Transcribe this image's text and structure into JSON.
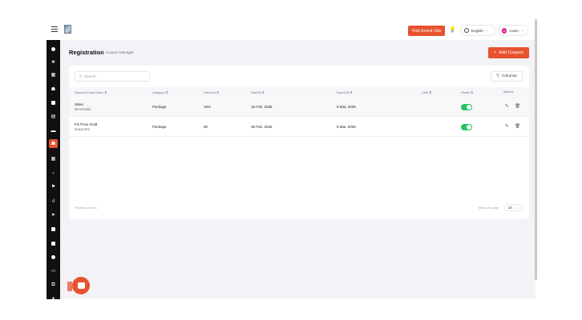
{
  "topbar": {
    "visit_event_site": "Visit Event Site",
    "language": "English",
    "user_name": "Azam",
    "user_initial": "A"
  },
  "page": {
    "title": "Registration",
    "breadcrumb": "Coupon Manager",
    "add_coupon": "Add Coupon"
  },
  "table": {
    "search_placeholder": "Search",
    "columns_label": "Columns",
    "headers": [
      "Discount Code Name",
      "Category",
      "Discount",
      "Start At",
      "Expire At",
      "Limit",
      "Status",
      "Actions"
    ],
    "rows": [
      {
        "name": "Silver",
        "code": "WFH1S0WE",
        "category": "Package",
        "discount": "10%",
        "start": "15 Feb, 2025",
        "expire": "8 Mar, 2025",
        "limit": "",
        "status": "on"
      },
      {
        "name": "Fix Price Gold",
        "code": "SHA2KSRX",
        "category": "Package",
        "discount": "50",
        "start": "25 Feb, 2025",
        "expire": "8 Mar, 2025",
        "limit": "",
        "status": "on"
      }
    ],
    "showing": "Showing 2 items",
    "rows_per_page_label": "Items per page",
    "rows_per_page": "10"
  },
  "icons": {
    "sidebar": [
      "circle-icon",
      "star-icon",
      "grid-icon",
      "users-icon",
      "document-icon",
      "calendar-icon",
      "inbox-icon",
      "ticket-icon",
      "apps-icon",
      "share-icon",
      "flag-icon",
      "chart-icon",
      "send-icon",
      "clipboard-icon",
      "database-icon",
      "settings-icon",
      "mail-icon",
      "layers-icon",
      "bulb-icon"
    ]
  },
  "colors": {
    "accent": "#e8532f",
    "toggle_on": "#22c55e",
    "sidebar_bg": "#101010"
  }
}
